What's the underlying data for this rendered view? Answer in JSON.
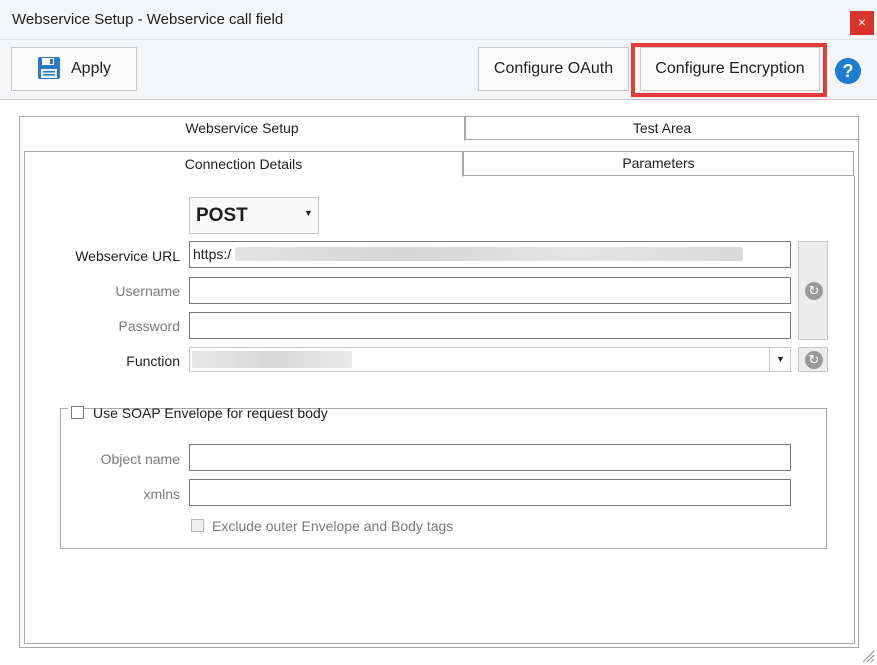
{
  "window": {
    "title": "Webservice Setup - Webservice call field",
    "close_glyph": "×"
  },
  "toolbar": {
    "apply_label": "Apply",
    "apply_icon": "floppy-disk-icon",
    "oauth_label": "Configure OAuth",
    "encryption_label": "Configure Encryption",
    "help_glyph": "?",
    "highlight_color": "#e33a3a"
  },
  "tabs": {
    "outer": [
      "Webservice Setup",
      "Test Area"
    ],
    "inner": [
      "Connection Details",
      "Parameters"
    ]
  },
  "form": {
    "method": "POST",
    "url_label": "Webservice URL",
    "url_value": "https:/",
    "username_label": "Username",
    "username_value": "",
    "password_label": "Password",
    "password_value": "",
    "function_label": "Function",
    "function_value": ""
  },
  "soap": {
    "use_soap_label": "Use SOAP Envelope for request body",
    "use_soap_checked": false,
    "object_name_label": "Object name",
    "object_name_value": "",
    "xmlns_label": "xmlns",
    "xmlns_value": "",
    "exclude_label": "Exclude outer Envelope and Body tags",
    "exclude_checked": false
  },
  "colors": {
    "help_blue": "#1a7fd4",
    "close_red": "#d9342b"
  }
}
